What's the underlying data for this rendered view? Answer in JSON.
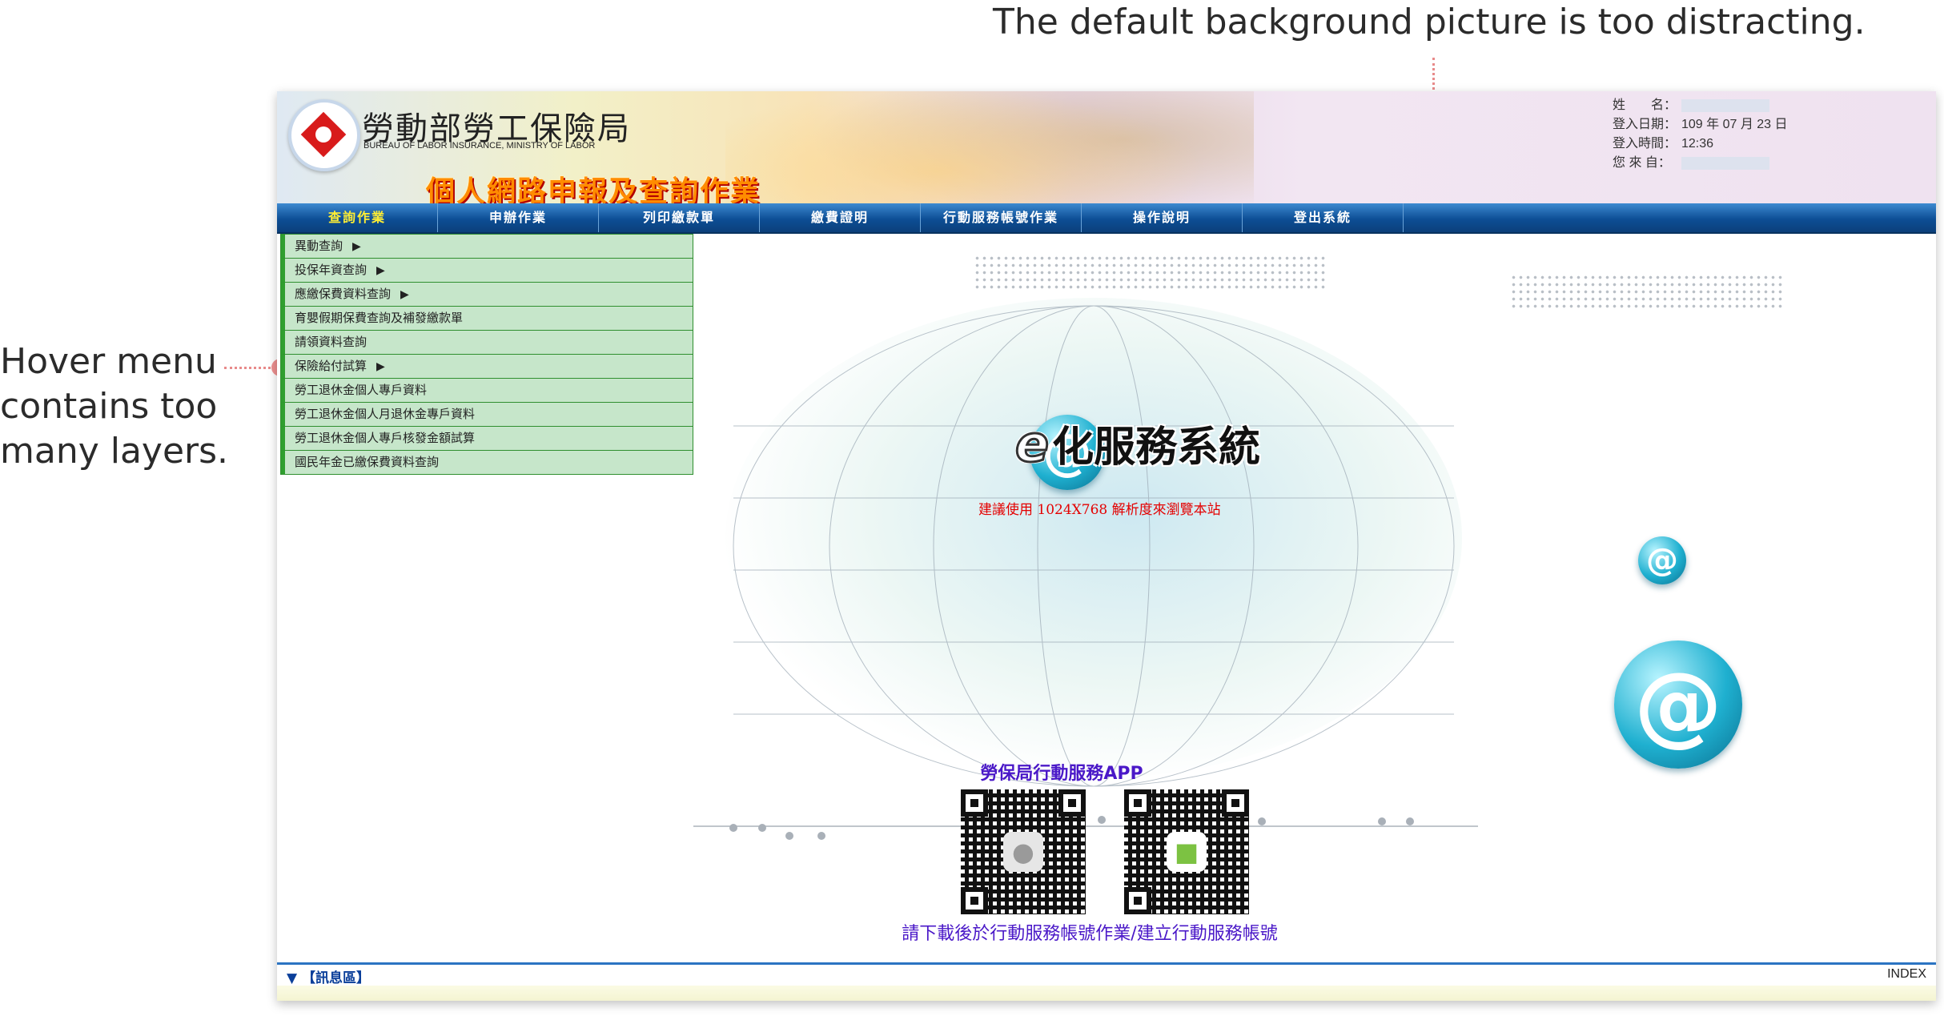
{
  "annotations": {
    "top": "The default background picture is too distracting.",
    "left_lines": [
      "Hover menu",
      "contains too",
      "many layers."
    ]
  },
  "header": {
    "org_name": "勞動部勞工保險局",
    "org_name_en": "BUREAU OF LABOR INSURANCE, MINISTRY OF LABOR",
    "app_title": "個人網路申報及查詢作業"
  },
  "userinfo": {
    "name_label": "姓　　名：",
    "login_date_label": "登入日期：",
    "login_date_value": "109 年 07 月 23 日",
    "login_time_label": "登入時間：",
    "login_time_value": "12:36",
    "from_label": "您 來 自："
  },
  "nav": {
    "items": [
      "查詢作業",
      "申辦作業",
      "列印繳款單",
      "繳費證明",
      "行動服務帳號作業",
      "操作說明",
      "登出系統"
    ],
    "active_index": 0
  },
  "menu": {
    "items": [
      {
        "label": "異動查詢",
        "submenu": true
      },
      {
        "label": "投保年資查詢",
        "submenu": true
      },
      {
        "label": "應繳保費資料查詢",
        "submenu": true
      },
      {
        "label": "育嬰假期保費查詢及補發繳款單",
        "submenu": false
      },
      {
        "label": "請領資料查詢",
        "submenu": false
      },
      {
        "label": "保險給付試算",
        "submenu": true
      },
      {
        "label": "勞工退休金個人專戶資料",
        "submenu": false
      },
      {
        "label": "勞工退休金個人月退休金專戶資料",
        "submenu": false
      },
      {
        "label": "勞工退休金個人專戶核發金額試算",
        "submenu": false
      },
      {
        "label": "國民年金已繳保費資料查詢",
        "submenu": false
      }
    ],
    "submenu_arrow": "▶"
  },
  "main": {
    "service_title": "化服務系統",
    "service_e": "e",
    "resolution_note": "建議使用  1024X768  解析度來瀏覽本站",
    "app_heading": "勞保局行動服務APP",
    "download_text": "請下載後於行動服務帳號作業/建立行動服務帳號",
    "at_symbol": "@",
    "apple_icon": "apple-icon",
    "android_icon": "android-icon"
  },
  "footer": {
    "message_zone": "▼ 【訊息區】",
    "index_label": "INDEX"
  },
  "colors": {
    "annotation_accent": "#ee9090",
    "nav_active": "#ffee33",
    "nav_bg": "#0d4e95",
    "menu_bg": "#c6e6ca",
    "menu_border": "#2f8f2f",
    "link_purple": "#4a18c8",
    "resolution_red": "#e40000"
  }
}
